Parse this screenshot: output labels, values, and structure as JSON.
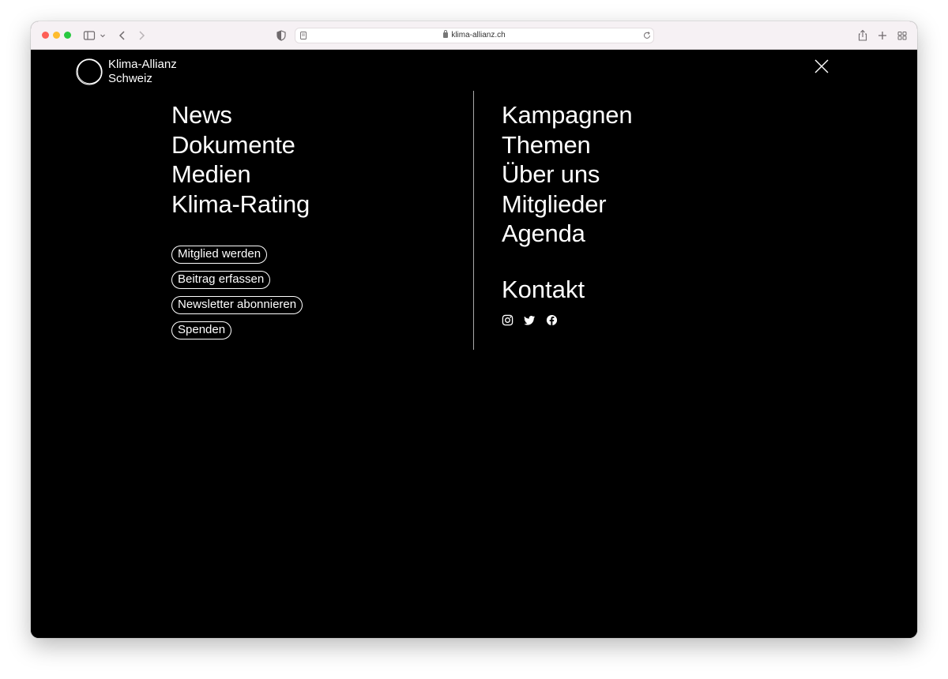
{
  "browser": {
    "url": "klima-allianz.ch"
  },
  "site": {
    "logo_line1": "Klima-Allianz",
    "logo_line2": "Schweiz"
  },
  "nav_left": [
    "News",
    "Dokumente",
    "Medien",
    "Klima-Rating"
  ],
  "nav_right": [
    "Kampagnen",
    "Themen",
    "Über uns",
    "Mitglieder",
    "Agenda"
  ],
  "actions": [
    "Mitglied werden",
    "Beitrag erfassen",
    "Newsletter abonnieren",
    "Spenden"
  ],
  "contact": {
    "label": "Kontakt",
    "social": [
      "instagram-icon",
      "twitter-icon",
      "facebook-icon"
    ]
  },
  "colors": {
    "background": "#000000",
    "text": "#ffffff",
    "toolbar": "#f6f1f4"
  }
}
